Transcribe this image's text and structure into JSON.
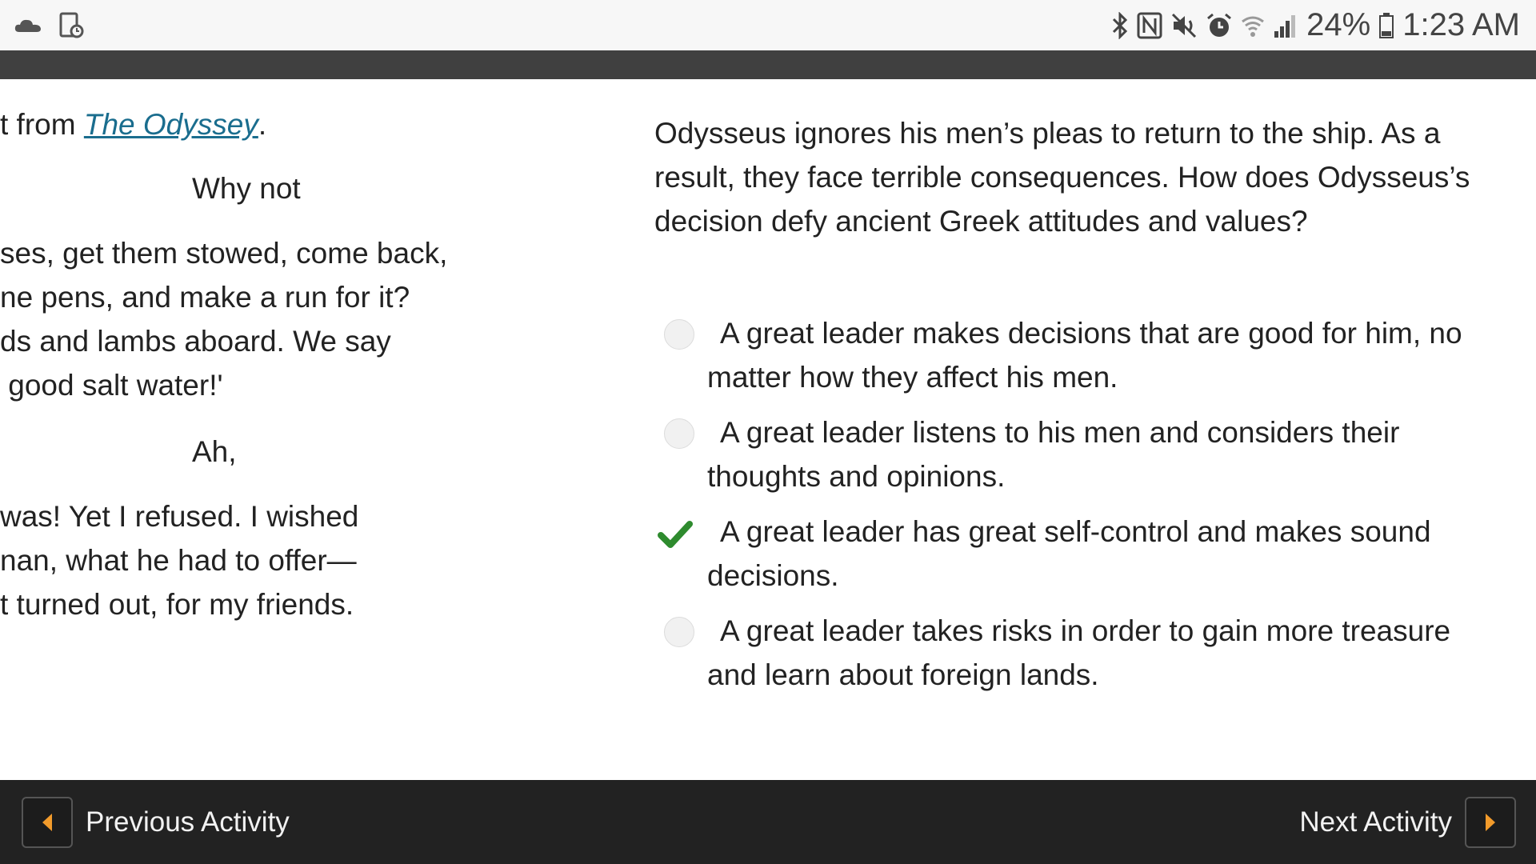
{
  "status_bar": {
    "left_icons": [
      "cloud-icon",
      "device-settings-icon"
    ],
    "right_icons": [
      "bluetooth-icon",
      "nfc-icon",
      "mute-icon",
      "alarm-icon",
      "wifi-icon",
      "signal-icon",
      "battery-icon"
    ],
    "battery": "24%",
    "time": "1:23 AM"
  },
  "passage": {
    "line1_prefix": "t from ",
    "line1_link": "The Odyssey",
    "line1_suffix": ".",
    "lines": [
      "Why not",
      "ses, get them stowed, come back,",
      "ne pens, and make a run for it?",
      "ds and lambs aboard. We say",
      " good salt water!'",
      "Ah,",
      "was! Yet I refused. I wished",
      "nan, what he had to offer—",
      "t turned out, for my friends."
    ]
  },
  "question": {
    "text": "Odysseus ignores his men’s pleas to return to the ship. As a result, they face terrible consequences. How does Odysseus’s decision defy ancient Greek attitudes and values?"
  },
  "options": [
    {
      "text": "A great leader makes decisions that are good for him, no matter how they affect his men.",
      "selected": false
    },
    {
      "text": "A great leader listens to his men and considers their thoughts and opinions.",
      "selected": false
    },
    {
      "text": "A great leader has great self-control and makes sound decisions.",
      "selected": true
    },
    {
      "text": "A great leader takes risks in order to gain more treasure and learn about  foreign lands.",
      "selected": false
    }
  ],
  "bottom_nav": {
    "previous_label": "Previous Activity",
    "next_label": "Next Activity"
  },
  "colors": {
    "accent_orange": "#f29b2b",
    "check_green": "#2e8b2e",
    "link_blue": "#1a6d8e"
  }
}
